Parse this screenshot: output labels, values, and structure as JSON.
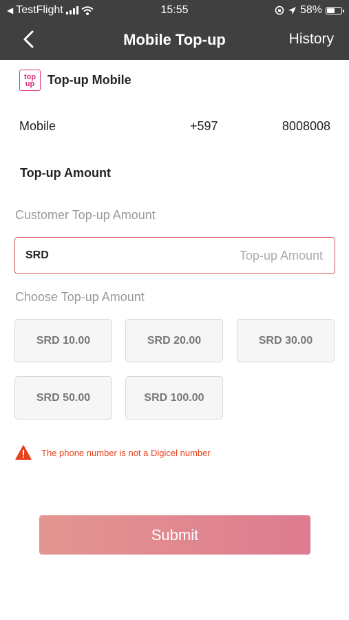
{
  "status_bar": {
    "carrier": "TestFlight",
    "time": "15:55",
    "battery_text": "58%",
    "battery_level": 0.58
  },
  "nav": {
    "title": "Mobile Top-up",
    "history_label": "History"
  },
  "brand": {
    "logo_line1": "top",
    "logo_line2": "up",
    "name": "Top-up Mobile"
  },
  "mobile": {
    "label": "Mobile",
    "country_code": "+597",
    "number": "8008008"
  },
  "topup": {
    "section_title": "Top-up Amount",
    "customer_caption": "Customer Top-up Amount",
    "currency": "SRD",
    "amount_placeholder": "Top-up Amount",
    "choose_caption": "Choose Top-up Amount",
    "options": [
      "SRD 10.00",
      "SRD 20.00",
      "SRD 30.00",
      "SRD 50.00",
      "SRD 100.00"
    ]
  },
  "error": {
    "message": "The phone number is not a Digicel number"
  },
  "submit_label": "Submit",
  "colors": {
    "header_bg": "#404040",
    "error": "#e8421c",
    "input_border": "#d94a5a",
    "submit_gradient_start": "#e39690",
    "submit_gradient_end": "#de7b90"
  }
}
